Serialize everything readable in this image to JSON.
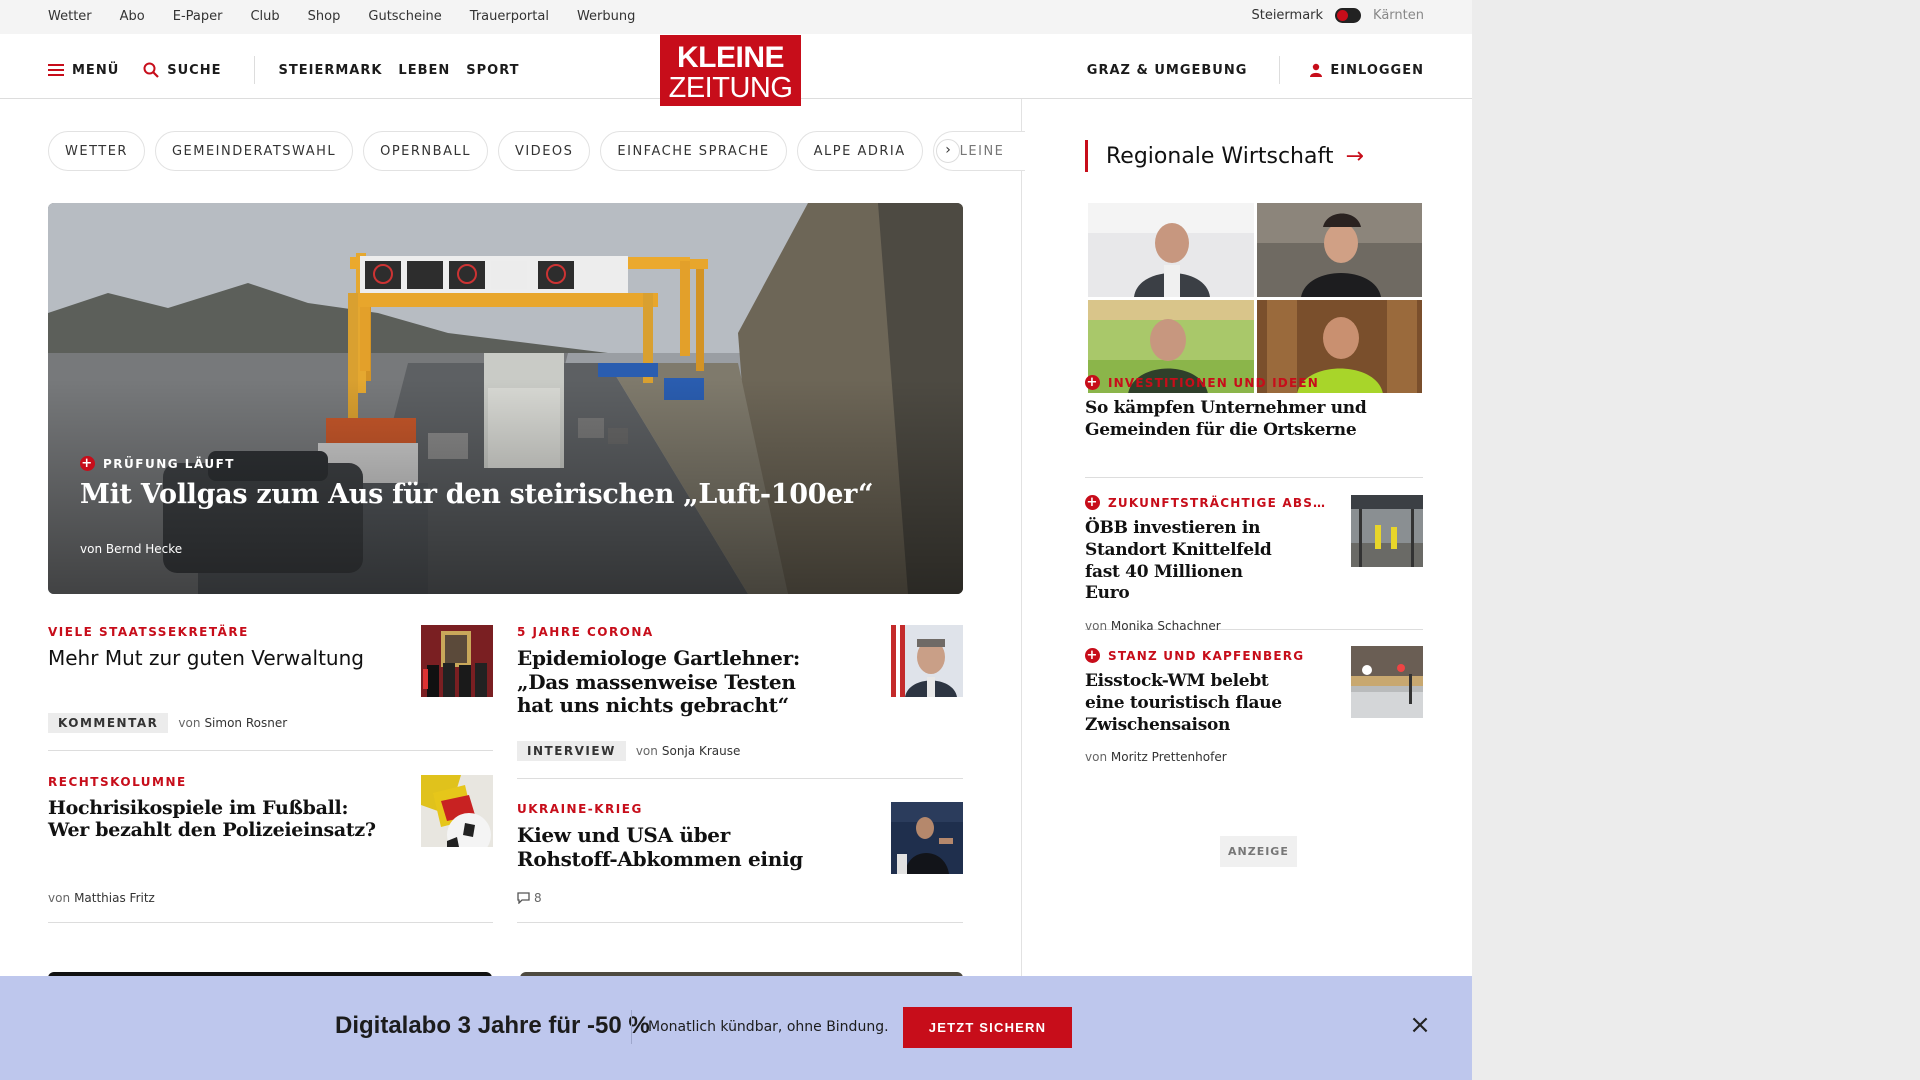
{
  "utility_links": [
    "Wetter",
    "Abo",
    "E-Paper",
    "Club",
    "Shop",
    "Gutscheine",
    "Trauerportal",
    "Werbung"
  ],
  "region": {
    "active": "Steiermark",
    "inactive": "Kärnten"
  },
  "header": {
    "menu_label": "MENÜ",
    "search_label": "SUCHE",
    "nav": [
      "STEIERMARK",
      "LEBEN",
      "SPORT"
    ],
    "logo_line1": "KLEINE",
    "logo_line2": "ZEITUNG",
    "location_label": "GRAZ & UMGEBUNG",
    "login_label": "EINLOGGEN"
  },
  "tags": [
    "WETTER",
    "GEMEINDERATSWAHL",
    "OPERNBALL",
    "VIDEOS",
    "EINFACHE SPRACHE",
    "ALPE ADRIA",
    "KLEINE"
  ],
  "hero": {
    "kicker": "PRÜFUNG LÄUFT",
    "title": "Mit Vollgas zum Aus für den steirischen „Luft-100er“",
    "author_prefix": "von",
    "author": "Bernd Hecke"
  },
  "articles": [
    {
      "kicker": "VIELE STAATSSEKRETÄRE",
      "title": "Mehr Mut zur guten Verwaltung",
      "badge": "KOMMENTAR",
      "author_prefix": "von",
      "author": "Simon Rosner"
    },
    {
      "kicker": "5 JAHRE CORONA",
      "title": "Epidemiologe Gartlehner: „Das massenweise Testen hat uns nichts gebracht“",
      "badge": "INTERVIEW",
      "author_prefix": "von",
      "author": "Sonja Krause"
    },
    {
      "kicker": "RECHTSKOLUMNE",
      "title": "Hochrisikospiele im Fußball: Wer bezahlt den Polizeieinsatz?",
      "author_prefix": "von",
      "author": "Matthias Fritz"
    },
    {
      "kicker": "UKRAINE-KRIEG",
      "title": "Kiew und USA über Rohstoff-Abkommen einig",
      "comments": "8"
    }
  ],
  "sidebar": {
    "heading": "Regionale Wirtschaft",
    "items": [
      {
        "kicker": "INVESTITIONEN UND IDEEN",
        "title": "So kämpfen Unternehmer und Gemeinden für die Ortskerne"
      },
      {
        "kicker": "ZUKUNFTSTRÄCHTIGE ABS…",
        "title": "ÖBB investieren in Standort Knittelfeld fast 40 Millionen Euro",
        "author_prefix": "von",
        "author": "Monika Schachner"
      },
      {
        "kicker": "STANZ UND KAPFENBERG",
        "title": "Eisstock-WM belebt eine touristisch flaue Zwischensaison",
        "author_prefix": "von",
        "author": "Moritz Prettenhofer"
      }
    ],
    "ad_label": "ANZEIGE"
  },
  "banner": {
    "title": "Digitalabo 3 Jahre für -50 %",
    "subtitle": "Monatlich kündbar, ohne Bindung.",
    "cta": "JETZT SICHERN"
  },
  "colors": {
    "brand_red": "#c70d1a",
    "banner_bg": "#bec7ed"
  }
}
